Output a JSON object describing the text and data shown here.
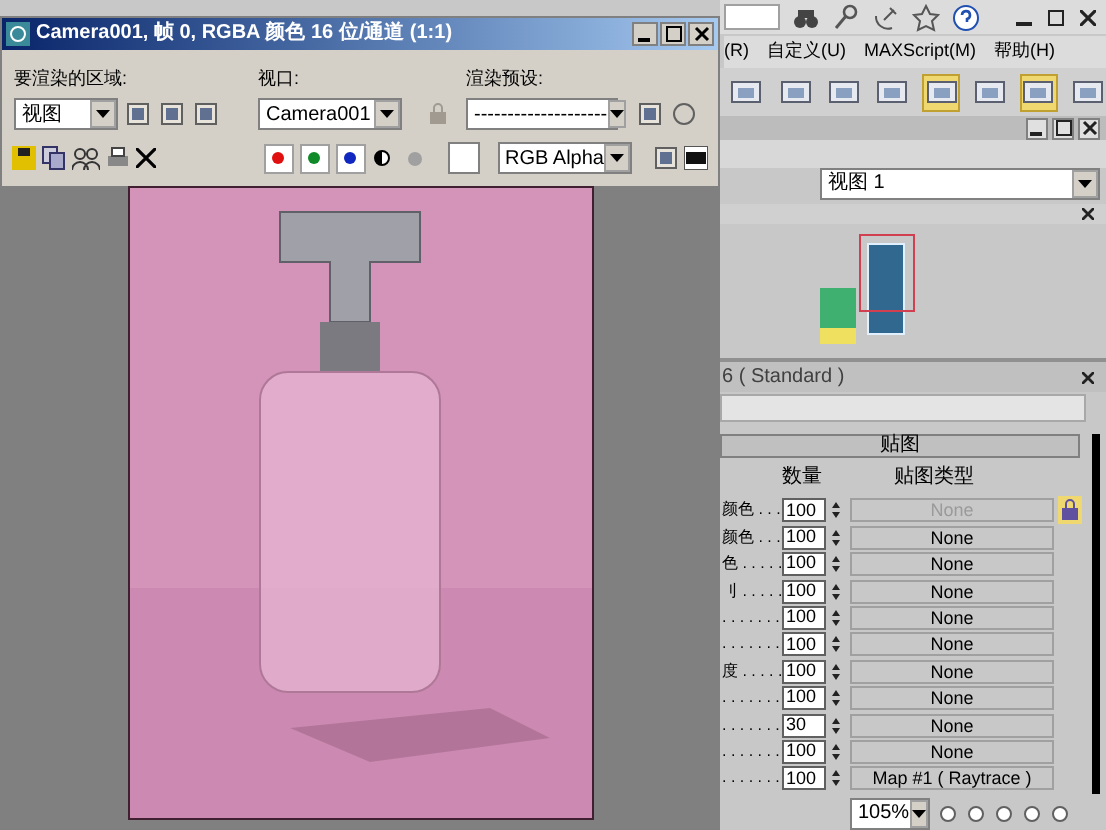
{
  "app": {
    "menu": [
      "(R)",
      "自定义(U)",
      "MAXScript(M)",
      "帮助(H)"
    ],
    "material_editor": {
      "view": "视图 1",
      "rollout_title": "6 ( Standard )",
      "maps_title": "贴图",
      "columns": [
        "数量",
        "贴图类型"
      ],
      "rows": [
        {
          "label": "颜色 . . .",
          "amount": "100",
          "map": "None",
          "disabled": true
        },
        {
          "label": "颜色 . . .",
          "amount": "100",
          "map": "None",
          "disabled": false
        },
        {
          "label": "色 . . . . .",
          "amount": "100",
          "map": "None",
          "disabled": false
        },
        {
          "label": "刂 . . . . .",
          "amount": "100",
          "map": "None",
          "disabled": false
        },
        {
          "label": ". . . . . . .",
          "amount": "100",
          "map": "None",
          "disabled": false
        },
        {
          "label": ". . . . . . .",
          "amount": "100",
          "map": "None",
          "disabled": false
        },
        {
          "label": "度 . . . . .",
          "amount": "100",
          "map": "None",
          "disabled": false
        },
        {
          "label": ". . . . . . .",
          "amount": "100",
          "map": "None",
          "disabled": false
        },
        {
          "label": ". . . . . . .",
          "amount": "30",
          "map": "None",
          "disabled": false
        },
        {
          "label": ". . . . . . .",
          "amount": "100",
          "map": "None",
          "disabled": false
        },
        {
          "label": ". . . . . . .",
          "amount": "100",
          "map": "Map #1 ( Raytrace )",
          "disabled": false
        }
      ],
      "zoom": "105%"
    }
  },
  "render_window": {
    "title": "Camera001, 帧 0, RGBA 颜色 16 位/通道 (1:1)",
    "area": {
      "label": "要渲染的区域:",
      "value": "视图"
    },
    "viewport": {
      "label": "视口:",
      "value": "Camera001"
    },
    "preset": {
      "label": "渲染预设:",
      "value": "--------------------"
    },
    "channel_buttons": [
      {
        "color": "#e01010"
      },
      {
        "color": "#108a28"
      },
      {
        "color": "#1028c0"
      }
    ],
    "display": "RGB Alpha"
  }
}
